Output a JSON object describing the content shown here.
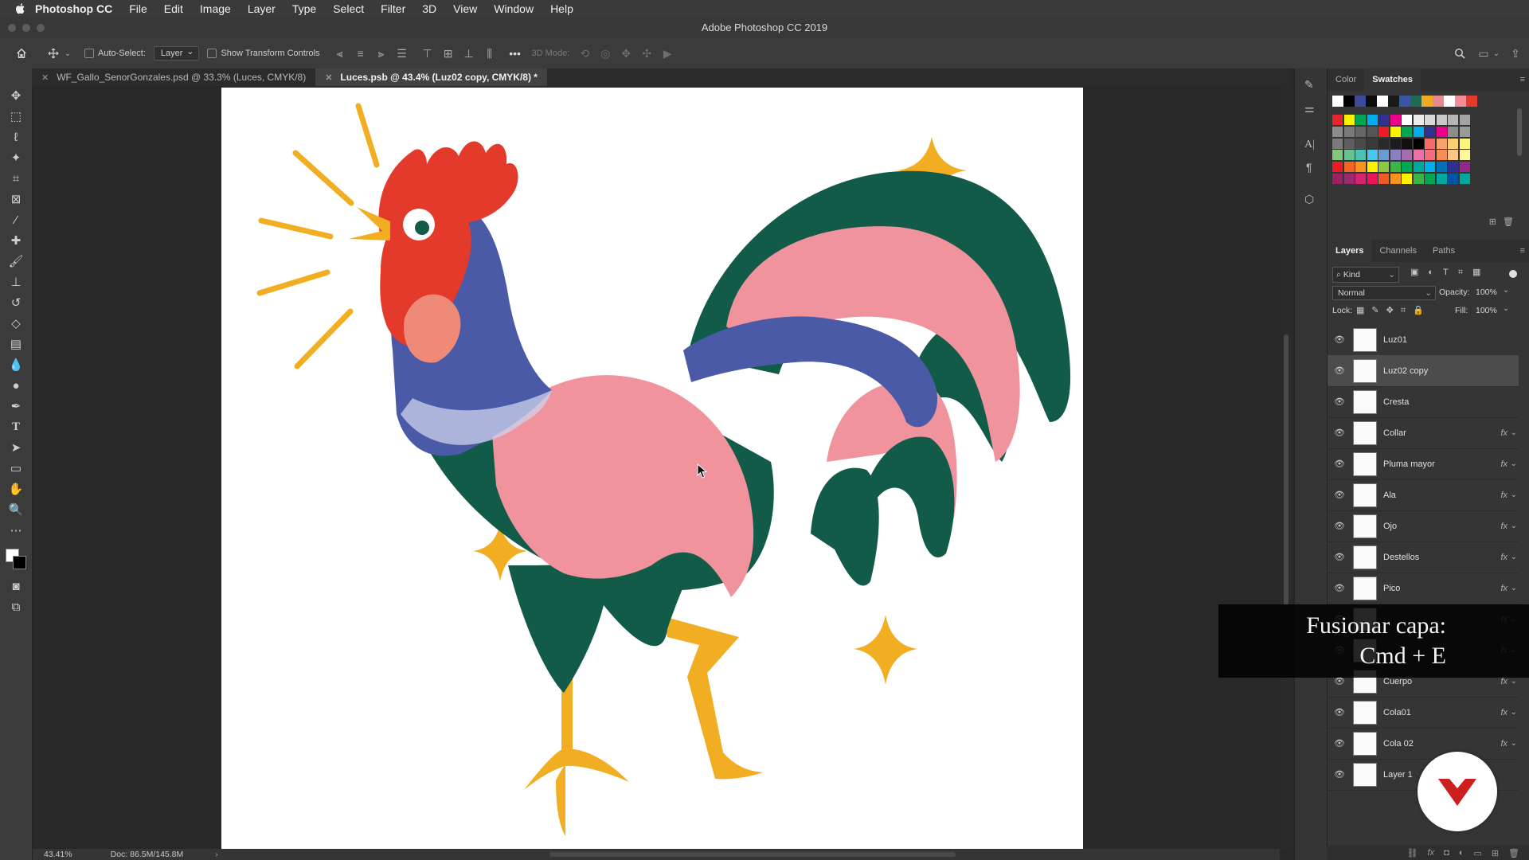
{
  "menubar": {
    "app_name": "Photoshop CC",
    "items": [
      "File",
      "Edit",
      "Image",
      "Layer",
      "Type",
      "Select",
      "Filter",
      "3D",
      "View",
      "Window",
      "Help"
    ]
  },
  "window_title": "Adobe Photoshop CC 2019",
  "options_bar": {
    "auto_select_label": "Auto-Select:",
    "auto_select_value": "Layer",
    "show_transform_label": "Show Transform Controls",
    "mode_3d_label": "3D Mode:",
    "more_label": "•••"
  },
  "tabs": [
    {
      "label": "WF_Gallo_SenorGonzales.psd @ 33.3% (Luces, CMYK/8)",
      "active": false
    },
    {
      "label": "Luces.psb @ 43.4% (Luz02 copy, CMYK/8) *",
      "active": true
    }
  ],
  "status": {
    "zoom": "43.41%",
    "doc": "Doc: 86.5M/145.8M"
  },
  "color_panel": {
    "tabs": [
      "Color",
      "Swatches"
    ],
    "active_tab": "Swatches",
    "recent": [
      "#ffffff",
      "#000000",
      "#3d4a9a",
      "#0d0d0d",
      "#ffffff",
      "#1a1a1a",
      "#3a55a6",
      "#1e6a52",
      "#f2a922",
      "#e48a8c",
      "#ffffff",
      "#f28d97",
      "#e43a2c"
    ],
    "grid_rows": [
      [
        "#e6262a",
        "#fff200",
        "#00a651",
        "#00aeef",
        "#2e3192",
        "#ec008c",
        "#ffffff",
        "#ececec",
        "#d9d9d9",
        "#c8c8c8",
        "#b5b5b5",
        "#a3a3a3"
      ],
      [
        "#8c8c8c",
        "#7a7a7a",
        "#666666",
        "#555555",
        "#ed1c24",
        "#fff200",
        "#00a651",
        "#00aeef",
        "#2e3192",
        "#ec008c",
        "#8c8c8c",
        "#9a9a9a"
      ],
      [
        "#7a7a7a",
        "#5e5e5e",
        "#4a4a4a",
        "#3a3a3a",
        "#2a2a2a",
        "#1c1c1c",
        "#101010",
        "#000000",
        "#f26c6c",
        "#f7a46b",
        "#fbd072",
        "#fff57d"
      ],
      [
        "#84c67e",
        "#6ac08f",
        "#4dc1b6",
        "#4ac7ed",
        "#6c9bd2",
        "#8781bd",
        "#a36eae",
        "#f06eaa",
        "#f26d7d",
        "#f68e56",
        "#fdc689",
        "#fff799"
      ],
      [
        "#ed1c24",
        "#f26522",
        "#f7941d",
        "#fff200",
        "#8dc63f",
        "#39b54a",
        "#00a651",
        "#00a99d",
        "#00aeef",
        "#0072bc",
        "#2e3192",
        "#92278f"
      ],
      [
        "#9e1f63",
        "#9a2a6f",
        "#d6246e",
        "#ed145b",
        "#f15a24",
        "#f7941d",
        "#fff200",
        "#39b54a",
        "#00a651",
        "#00a99d",
        "#0054a6",
        "#00a99d"
      ]
    ]
  },
  "layers_panel": {
    "tabs": [
      "Layers",
      "Channels",
      "Paths"
    ],
    "active_tab": "Layers",
    "kind_label": "Kind",
    "blend_mode": "Normal",
    "opacity_label": "Opacity:",
    "opacity_value": "100%",
    "lock_label": "Lock:",
    "fill_label": "Fill:",
    "fill_value": "100%",
    "layers": [
      {
        "name": "Luz01",
        "fx": "",
        "selected": false
      },
      {
        "name": "Luz02 copy",
        "fx": "",
        "selected": true
      },
      {
        "name": "Cresta",
        "fx": "",
        "selected": false
      },
      {
        "name": "Collar",
        "fx": "fx",
        "selected": false
      },
      {
        "name": "Pluma mayor",
        "fx": "fx",
        "selected": false
      },
      {
        "name": "Ala",
        "fx": "fx",
        "selected": false
      },
      {
        "name": "Ojo",
        "fx": "fx",
        "selected": false
      },
      {
        "name": "Destellos",
        "fx": "fx",
        "selected": false
      },
      {
        "name": "Pico",
        "fx": "fx",
        "selected": false
      },
      {
        "name": "",
        "fx": "fx",
        "selected": false
      },
      {
        "name": "",
        "fx": "fx",
        "selected": false
      },
      {
        "name": "Cuerpo",
        "fx": "fx",
        "selected": false
      },
      {
        "name": "Cola01",
        "fx": "fx",
        "selected": false
      },
      {
        "name": "Cola 02",
        "fx": "fx",
        "selected": false
      },
      {
        "name": "Layer 1",
        "fx": "",
        "selected": false
      }
    ]
  },
  "overlay": {
    "line1": "Fusionar capa:",
    "line2": "Cmd + E"
  },
  "artwork_colors": {
    "red": "#e43a2c",
    "blue": "#4a5aa6",
    "green": "#125b49",
    "pink": "#f0939c",
    "yellow": "#f2ae22",
    "white": "#ffffff"
  }
}
